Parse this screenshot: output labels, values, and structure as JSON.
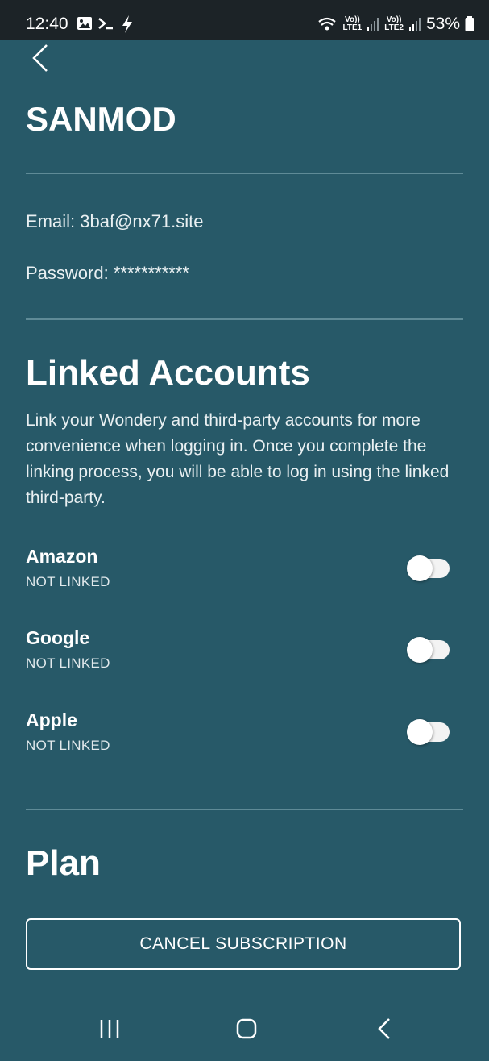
{
  "status_bar": {
    "time": "12:40",
    "sim1": [
      "Vo))",
      "LTE1"
    ],
    "sim2": [
      "Vo))",
      "LTE2"
    ],
    "battery": "53%",
    "icons": [
      "image-icon",
      "terminal-icon",
      "bolt-icon",
      "wifi-icon",
      "signal-icon",
      "battery-icon"
    ]
  },
  "profile": {
    "title": "SANMOD",
    "email_label": "Email: 3baf@nx71.site",
    "password_label": "Password: ***********"
  },
  "linked_accounts": {
    "heading": "Linked Accounts",
    "description": "Link your Wondery and third-party accounts for more convenience when logging in. Once you complete the linking process, you will be able to log in using the linked third-party.",
    "accounts": [
      {
        "name": "Amazon",
        "status": "NOT LINKED",
        "linked": false
      },
      {
        "name": "Google",
        "status": "NOT LINKED",
        "linked": false
      },
      {
        "name": "Apple",
        "status": "NOT LINKED",
        "linked": false
      }
    ]
  },
  "plan": {
    "heading": "Plan",
    "cancel_label": "CANCEL SUBSCRIPTION"
  },
  "colors": {
    "background": "#275968",
    "status_bar": "#1c2327",
    "divider": "#5f8b97"
  }
}
